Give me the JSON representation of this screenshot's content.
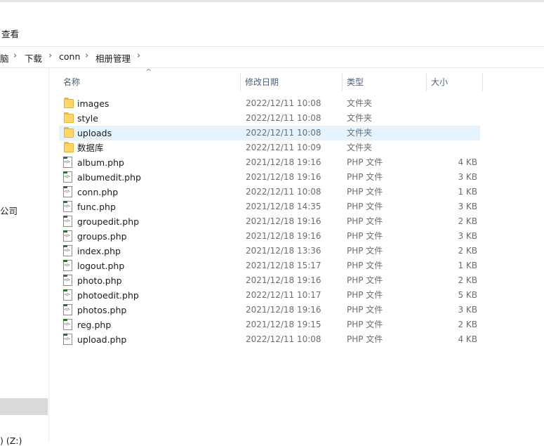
{
  "ribbon": {
    "view_tab": "查看"
  },
  "address": {
    "crumbs": [
      "脑",
      "下载",
      "conn",
      "相册管理"
    ],
    "separator": "›"
  },
  "nav": {
    "item_company": "公司",
    "item_drive": ") (Z:)"
  },
  "columns": {
    "name": "名称",
    "date": "修改日期",
    "type": "类型",
    "size": "大小"
  },
  "files": [
    {
      "name": "images",
      "date": "2022/12/11 10:08",
      "type": "文件夹",
      "size": "",
      "kind": "folder"
    },
    {
      "name": "style",
      "date": "2022/12/11 10:08",
      "type": "文件夹",
      "size": "",
      "kind": "folder"
    },
    {
      "name": "uploads",
      "date": "2022/12/11 10:08",
      "type": "文件夹",
      "size": "",
      "kind": "folder",
      "selected": true
    },
    {
      "name": "数据库",
      "date": "2022/12/11 10:09",
      "type": "文件夹",
      "size": "",
      "kind": "folder"
    },
    {
      "name": "album.php",
      "date": "2021/12/18 19:16",
      "type": "PHP 文件",
      "size": "4 KB",
      "kind": "php"
    },
    {
      "name": "albumedit.php",
      "date": "2021/12/18 19:16",
      "type": "PHP 文件",
      "size": "3 KB",
      "kind": "php"
    },
    {
      "name": "conn.php",
      "date": "2022/12/11 10:08",
      "type": "PHP 文件",
      "size": "1 KB",
      "kind": "php"
    },
    {
      "name": "func.php",
      "date": "2021/12/18 14:35",
      "type": "PHP 文件",
      "size": "3 KB",
      "kind": "php"
    },
    {
      "name": "groupedit.php",
      "date": "2021/12/18 19:16",
      "type": "PHP 文件",
      "size": "2 KB",
      "kind": "php"
    },
    {
      "name": "groups.php",
      "date": "2021/12/18 19:16",
      "type": "PHP 文件",
      "size": "3 KB",
      "kind": "php"
    },
    {
      "name": "index.php",
      "date": "2021/12/18 13:36",
      "type": "PHP 文件",
      "size": "2 KB",
      "kind": "php"
    },
    {
      "name": "logout.php",
      "date": "2021/12/18 15:17",
      "type": "PHP 文件",
      "size": "1 KB",
      "kind": "php"
    },
    {
      "name": "photo.php",
      "date": "2021/12/18 19:16",
      "type": "PHP 文件",
      "size": "2 KB",
      "kind": "php"
    },
    {
      "name": "photoedit.php",
      "date": "2022/12/11 10:17",
      "type": "PHP 文件",
      "size": "5 KB",
      "kind": "php"
    },
    {
      "name": "photos.php",
      "date": "2021/12/18 19:16",
      "type": "PHP 文件",
      "size": "3 KB",
      "kind": "php"
    },
    {
      "name": "reg.php",
      "date": "2021/12/18 19:15",
      "type": "PHP 文件",
      "size": "2 KB",
      "kind": "php"
    },
    {
      "name": "upload.php",
      "date": "2022/12/11 10:08",
      "type": "PHP 文件",
      "size": "4 KB",
      "kind": "php"
    }
  ]
}
